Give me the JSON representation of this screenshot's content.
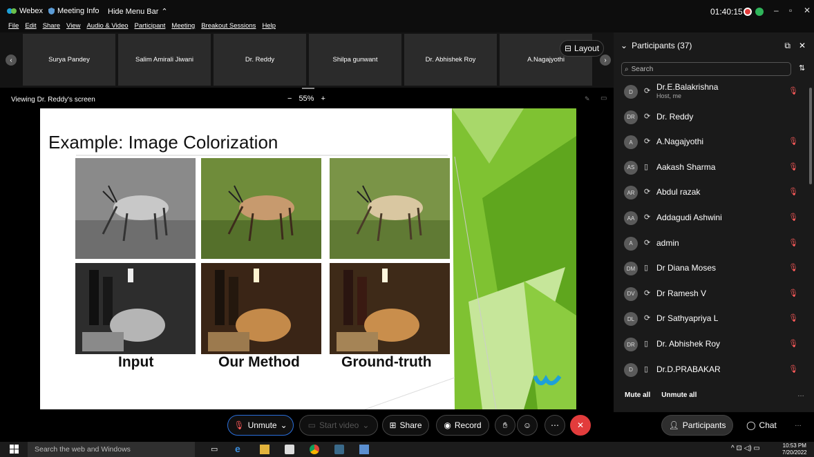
{
  "titlebar": {
    "app_name": "Webex",
    "meeting_info": "Meeting Info",
    "hide_menu": "Hide Menu Bar",
    "clock": "01:40:15"
  },
  "menu": [
    "File",
    "Edit",
    "Share",
    "View",
    "Audio & Video",
    "Participant",
    "Meeting",
    "Breakout Sessions",
    "Help"
  ],
  "tiles": [
    "Surya Pandey",
    "Salim Amirali Jiwani",
    "Dr. Reddy",
    "Shilpa gunwant",
    "Dr. Abhishek Roy",
    "A.Nagajyothi"
  ],
  "layout_label": "Layout",
  "viewing": "Viewing Dr. Reddy's screen",
  "zoom": {
    "minus": "−",
    "value": "55%",
    "plus": "+"
  },
  "slide": {
    "title": "Example: Image Colorization",
    "labels": [
      "Input",
      "Our Method",
      "Ground-truth"
    ]
  },
  "panel": {
    "title": "Participants (37)",
    "search_placeholder": "Search",
    "participants": [
      {
        "initials": "D",
        "name": "Dr.E.Balakrishna",
        "sub": "Host, me",
        "device": "headset",
        "muted": true
      },
      {
        "initials": "DR",
        "name": "Dr. Reddy",
        "sub": "",
        "device": "headset",
        "muted": false
      },
      {
        "initials": "A",
        "name": "A.Nagajyothi",
        "sub": "",
        "device": "headset",
        "muted": true
      },
      {
        "initials": "AS",
        "name": "Aakash Sharma",
        "sub": "",
        "device": "phone",
        "muted": true
      },
      {
        "initials": "AR",
        "name": "Abdul razak",
        "sub": "",
        "device": "headset",
        "muted": true
      },
      {
        "initials": "AA",
        "name": "Addagudi Ashwini",
        "sub": "",
        "device": "headset",
        "muted": true
      },
      {
        "initials": "A",
        "name": "admin",
        "sub": "",
        "device": "headset",
        "muted": true
      },
      {
        "initials": "DM",
        "name": "Dr Diana Moses",
        "sub": "",
        "device": "phone",
        "muted": true
      },
      {
        "initials": "DV",
        "name": "Dr Ramesh V",
        "sub": "",
        "device": "headset",
        "muted": true
      },
      {
        "initials": "DL",
        "name": "Dr Sathyapriya L",
        "sub": "",
        "device": "headset",
        "muted": true
      },
      {
        "initials": "DR",
        "name": "Dr. Abhishek Roy",
        "sub": "",
        "device": "phone",
        "muted": true
      },
      {
        "initials": "D",
        "name": "Dr.D.PRABAKAR",
        "sub": "",
        "device": "phone",
        "muted": true
      }
    ],
    "mute_all": "Mute all",
    "unmute_all": "Unmute all"
  },
  "controls": {
    "unmute": "Unmute",
    "start_video": "Start video",
    "share": "Share",
    "record": "Record",
    "participants": "Participants",
    "chat": "Chat"
  },
  "taskbar": {
    "search_placeholder": "Search the web and Windows",
    "time": "10:53 PM",
    "date": "7/20/2022"
  },
  "colors": {
    "accent_green": "#7fc232",
    "end_red": "#e23c3c",
    "mute_red": "#ff5a5a"
  }
}
